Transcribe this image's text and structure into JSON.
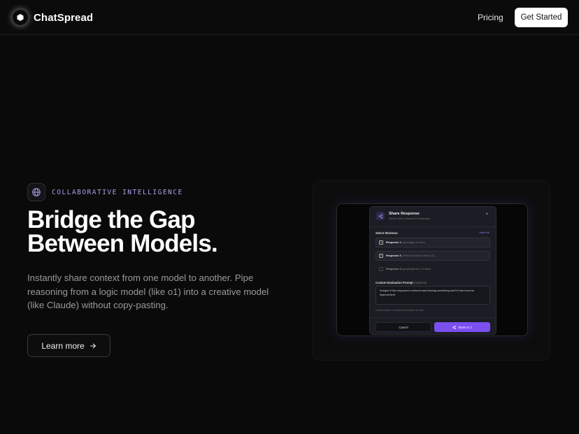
{
  "header": {
    "brand": "ChatSpread",
    "nav_pricing": "Pricing",
    "cta": "Get Started"
  },
  "hero": {
    "badge": "COLLABORATIVE INTELLIGENCE",
    "title_line1": "Bridge the Gap",
    "title_line2": "Between Models.",
    "description": "Instantly share context from one model to another. Pipe reasoning from a logic model (like o1) into a creative model (like Claude) without copy-pasting.",
    "learn_more": "Learn more"
  },
  "preview_modal": {
    "title": "Share Response",
    "subtitle": "Send to other windows for evaluation",
    "close": "×",
    "select_windows": "Select Windows",
    "select_all": "Select All",
    "windows": [
      {
        "name": "Response 1",
        "model": "(openai/gpt-5-nano)",
        "checked": true
      },
      {
        "name": "Response 3",
        "model": "(anthropic/claude-haiku-4.5)",
        "checked": true
      },
      {
        "name": "Response 4",
        "model": "(google/gemini-2.5-flash)",
        "checked": false
      }
    ],
    "prompt_label": "Custom Evaluation Prompt",
    "prompt_optional": "(Optional)",
    "prompt_value": "Analyze if this response is coherent and missing something and if it has room for improvement",
    "hint": "Leave empty to use default evaluation prompt",
    "cancel": "Cancel",
    "share": "Share to 2"
  },
  "colors": {
    "accent": "#7b4ff0",
    "badge_text": "#a7a1e8",
    "background": "#0a0a0a"
  }
}
